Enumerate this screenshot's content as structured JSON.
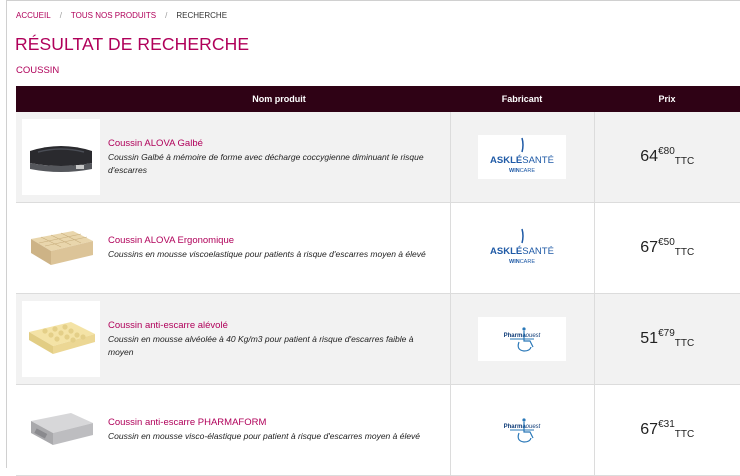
{
  "breadcrumb": {
    "home": "ACCUEIL",
    "products": "TOUS NOS PRODUITS",
    "current": "RECHERCHE",
    "separator": "/"
  },
  "page": {
    "title": "RÉSULTAT DE RECHERCHE",
    "query": "COUSSIN"
  },
  "table": {
    "headers": {
      "name": "Nom produit",
      "manufacturer": "Fabricant",
      "price": "Prix"
    },
    "rows": [
      {
        "name": "Coussin ALOVA Galbé",
        "description": "Coussin Galbé à mémoire de forme avec décharge coccygienne diminuant le risque d'escarres",
        "manufacturer_logo": {
          "line1a": "ASKLÉ",
          "line1b": "SANTÉ",
          "line2a": "WIN",
          "line2b": "CARE"
        },
        "price": {
          "int": "64",
          "cents": "€80",
          "suffix": "TTC"
        },
        "image": "gel-seat-cushion"
      },
      {
        "name": "Coussin ALOVA Ergonomique",
        "description": "Coussins en mousse viscoelastique pour patients à risque d'escarres moyen à élevé",
        "manufacturer_logo": {
          "line1a": "ASKLÉ",
          "line1b": "SANTÉ",
          "line2a": "WIN",
          "line2b": "CARE"
        },
        "price": {
          "int": "67",
          "cents": "€50",
          "suffix": "TTC"
        },
        "image": "foam-cube-cushion"
      },
      {
        "name": "Coussin anti-escarre alévolé",
        "description": "Coussin en mousse alvéolée à 40 Kg/m3 pour patient à risque d'escarres faible à moyen",
        "manufacturer_logo": {
          "line1a": "Pharma",
          "line1b": "ouest"
        },
        "price": {
          "int": "51",
          "cents": "€79",
          "suffix": "TTC"
        },
        "image": "egg-crate-foam-cushion"
      },
      {
        "name": "Coussin anti-escarre PHARMAFORM",
        "description": "Coussin en mousse visco-élastique pour patient à risque d'escarres moyen à élevé",
        "manufacturer_logo": {
          "line1a": "Pharma",
          "line1b": "ouest"
        },
        "price": {
          "int": "67",
          "cents": "€31",
          "suffix": "TTC"
        },
        "image": "grey-covered-cushion"
      }
    ]
  },
  "colors": {
    "accent": "#b0005a",
    "header_bg": "#2f0215",
    "row_alt": "#f2f2f2",
    "askle_blue": "#1f5aa6"
  }
}
